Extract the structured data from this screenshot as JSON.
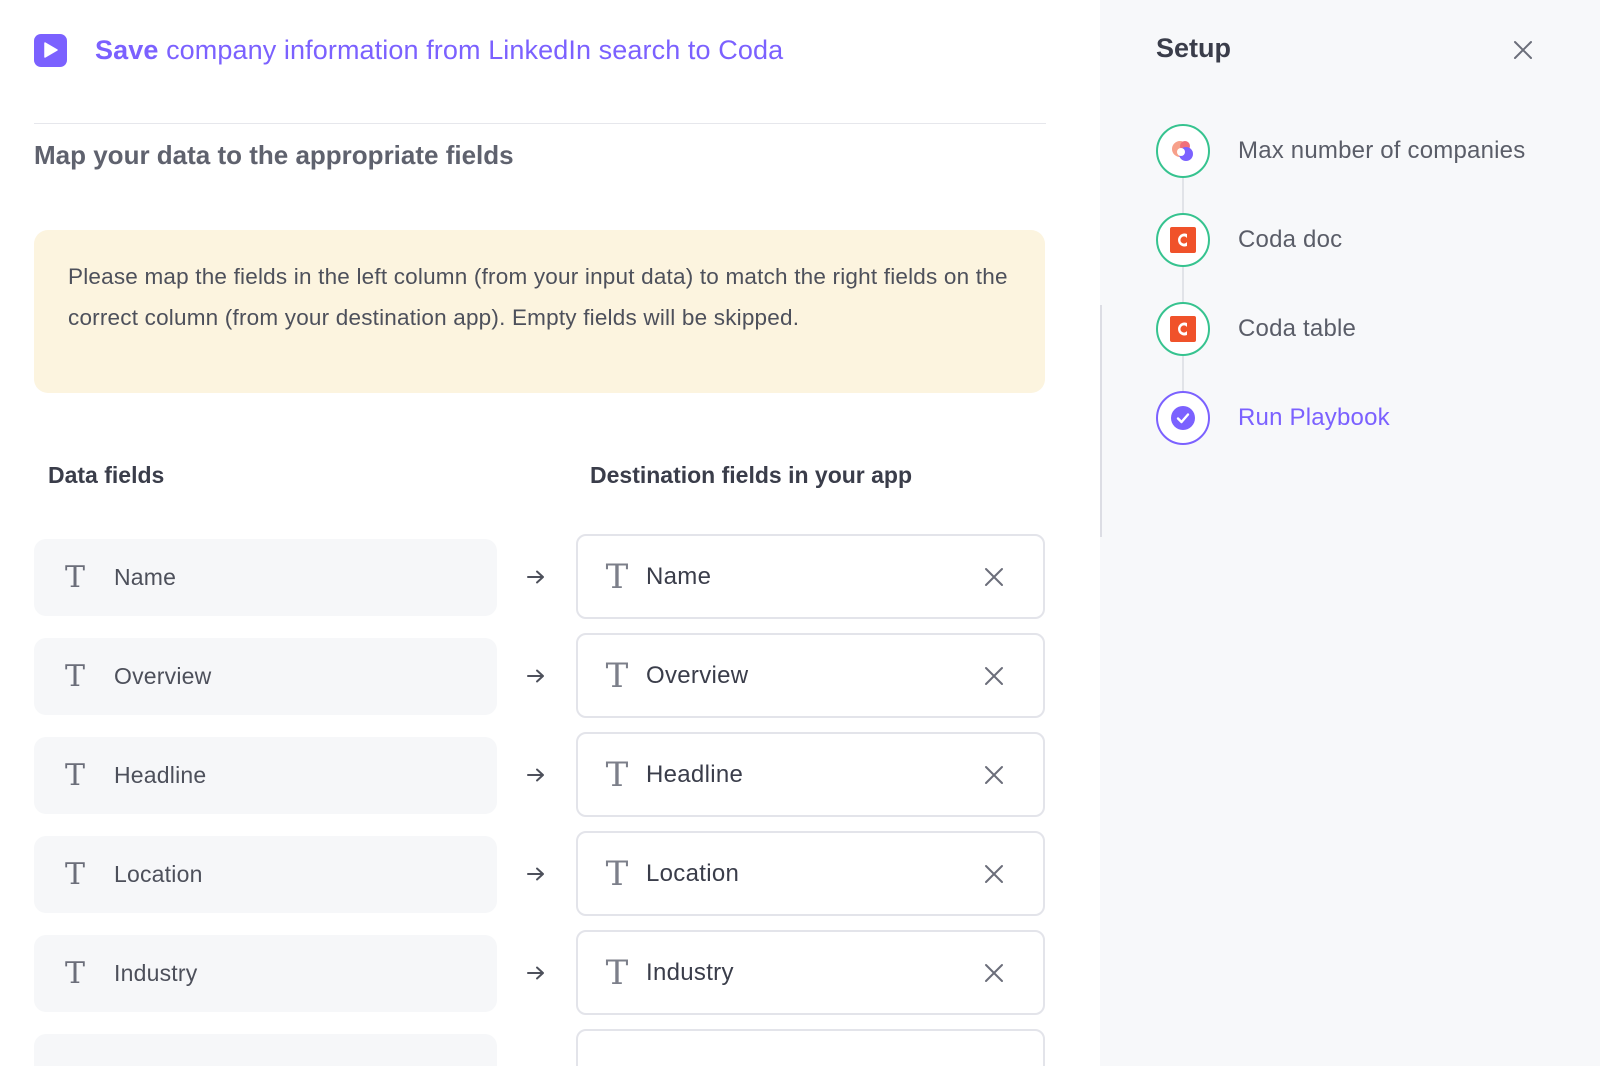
{
  "header": {
    "title_bold": "Save",
    "title_rest": " company information from LinkedIn search to Coda",
    "icon": "play-icon"
  },
  "section_title": "Map your data to the appropriate fields",
  "notice": "Please map the fields in the left column (from your input data) to match the right fields on the correct column (from your destination app). Empty fields will be skipped.",
  "columns": {
    "left": "Data fields",
    "right": "Destination fields in your app"
  },
  "mappings": [
    {
      "source": "Name",
      "destination": "Name"
    },
    {
      "source": "Overview",
      "destination": "Overview"
    },
    {
      "source": "Headline",
      "destination": "Headline"
    },
    {
      "source": "Location",
      "destination": "Location"
    },
    {
      "source": "Industry",
      "destination": "Industry"
    }
  ],
  "field_type_icon": "T",
  "setup": {
    "title": "Setup",
    "steps": [
      {
        "label": "Max number of companies",
        "icon": "app-logo-icon",
        "state": "done"
      },
      {
        "label": "Coda doc",
        "icon": "coda-icon",
        "state": "done"
      },
      {
        "label": "Coda table",
        "icon": "coda-icon",
        "state": "done"
      },
      {
        "label": "Run Playbook",
        "icon": "check-circle-icon",
        "state": "active"
      }
    ]
  },
  "colors": {
    "accent": "#7b61ff",
    "done": "#36c38f",
    "coda": "#f0522a",
    "notice_bg": "#fcf4df"
  }
}
